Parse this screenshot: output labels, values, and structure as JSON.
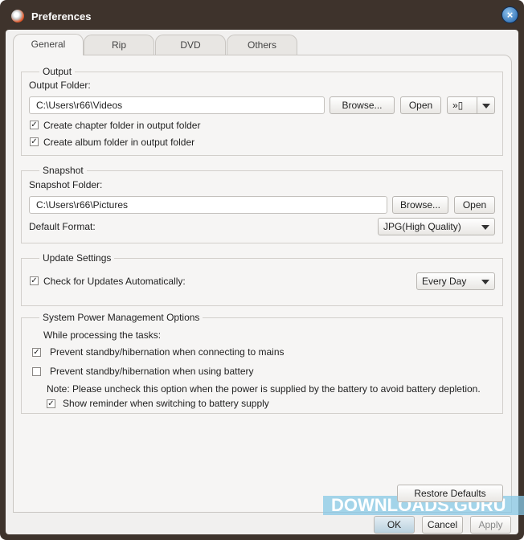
{
  "window": {
    "title": "Preferences"
  },
  "tabs": [
    "General",
    "Rip",
    "DVD",
    "Others"
  ],
  "output": {
    "group": "Output",
    "folder_label": "Output Folder:",
    "folder_value": "C:\\Users\\r66\\Videos",
    "browse": "Browse...",
    "open": "Open",
    "chapter": "Create chapter folder in output folder",
    "album": "Create album folder in output folder"
  },
  "snapshot": {
    "group": "Snapshot",
    "folder_label": "Snapshot Folder:",
    "folder_value": "C:\\Users\\r66\\Pictures",
    "browse": "Browse...",
    "open": "Open",
    "format_label": "Default Format:",
    "format_value": "JPG(High Quality)"
  },
  "update": {
    "group": "Update Settings",
    "check": "Check for Updates Automatically:",
    "freq": "Every Day"
  },
  "power": {
    "group": "System Power Management Options",
    "while": "While processing the tasks:",
    "mains": "Prevent standby/hibernation when connecting to mains",
    "battery": "Prevent standby/hibernation when using battery",
    "note": "Note: Please uncheck this option when the power is supplied by the battery to avoid battery depletion.",
    "reminder": "Show reminder when switching to battery supply"
  },
  "buttons": {
    "restore": "Restore Defaults",
    "ok": "OK",
    "cancel": "Cancel",
    "apply": "Apply"
  },
  "watermark": "DOWNLOADS.GURU"
}
